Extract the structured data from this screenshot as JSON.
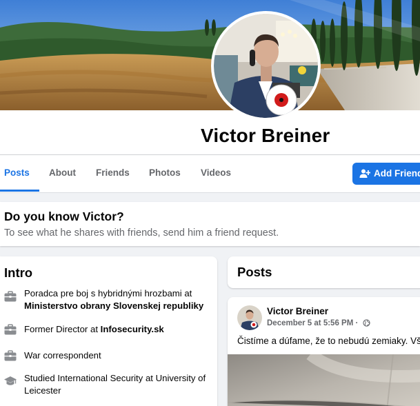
{
  "profile": {
    "name": "Victor Breiner"
  },
  "tabs": [
    {
      "label": "Posts",
      "active": true
    },
    {
      "label": "About",
      "active": false
    },
    {
      "label": "Friends",
      "active": false
    },
    {
      "label": "Photos",
      "active": false
    },
    {
      "label": "Videos",
      "active": false
    }
  ],
  "actions": {
    "add_friend_label": "Add Friend",
    "add_friend_icon": "person-plus-icon"
  },
  "know_card": {
    "title": "Do you know Victor?",
    "subtitle": "To see what he shares with friends, send him a friend request."
  },
  "intro": {
    "title": "Intro",
    "items": [
      {
        "icon": "briefcase-icon",
        "prefix": "Poradca pre boj s hybridnými hrozbami at ",
        "bold": "Ministerstvo obrany Slovenskej republiky"
      },
      {
        "icon": "briefcase-icon",
        "prefix": "Former Director at ",
        "bold": "Infosecurity.sk"
      },
      {
        "icon": "briefcase-icon",
        "prefix": "War correspondent",
        "bold": ""
      },
      {
        "icon": "graduation-cap-icon",
        "prefix": "Studied International Security at University of Leicester",
        "bold": ""
      }
    ]
  },
  "posts_section": {
    "title": "Posts"
  },
  "post": {
    "author": "Victor Breiner",
    "date": "December 5 at 5:56 PM",
    "separator": "·",
    "privacy_icon": "globe-icon",
    "text": "Čistíme a dúfame, že to nebudú zemiaky. Vš"
  },
  "colors": {
    "accent": "#1b74e4",
    "secondary_text": "#65676b",
    "background": "#f0f2f5"
  }
}
